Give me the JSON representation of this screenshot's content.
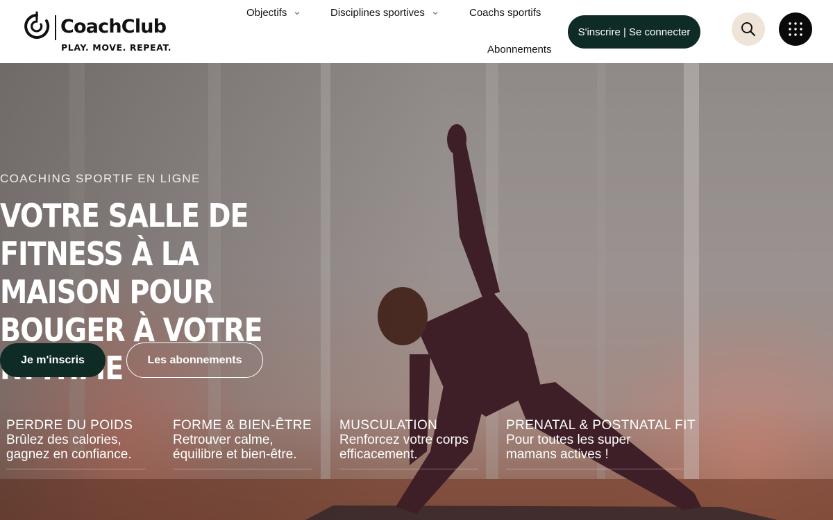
{
  "brand": {
    "name": "CoachClub",
    "tagline": "PLAY. MOVE. REPEAT."
  },
  "nav": {
    "objectifs": "Objectifs",
    "disciplines": "Disciplines sportives",
    "coachs": "Coachs sportifs",
    "abonnements": "Abonnements",
    "login": "S'inscrire | Se connecter"
  },
  "icons": {
    "search": "search-icon",
    "apps": "grid-dots-icon",
    "chevron": "chevron-down-icon"
  },
  "hero": {
    "eyebrow": "COACHING SPORTIF EN LIGNE",
    "title": "Votre salle de fitness à la maison pour bouger à votre rythme",
    "primary_cta": "Je m'inscris",
    "secondary_cta": "Les abonnements"
  },
  "categories": [
    {
      "title": "PERDRE DU POIDS",
      "desc": "Brûlez des calories, gagnez en confiance."
    },
    {
      "title": "FORME & BIEN-ÊTRE",
      "desc": "Retrouver calme, équilibre et bien-être."
    },
    {
      "title": "MUSCULATION",
      "desc": "Renforcez votre corps efficacement."
    },
    {
      "title": "PRENATAL & POSTNATAL FIT",
      "desc": "Pour toutes les super mamans actives !"
    }
  ],
  "colors": {
    "accent_dark": "#0f2b26",
    "search_bg": "#efe4d8",
    "apps_bg": "#0a0a0a"
  }
}
